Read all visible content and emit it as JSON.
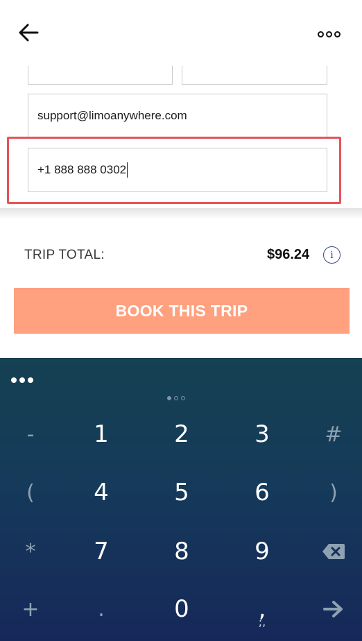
{
  "header": {
    "back_icon": "arrow-left-icon",
    "more_icon": "more-horizontal-icon"
  },
  "form": {
    "email_value": "support@limoanywhere.com",
    "phone_value": "+1 888 888 0302"
  },
  "summary": {
    "trip_total_label": "TRIP TOTAL:",
    "trip_total_amount": "$96.24",
    "info_icon": "info-icon",
    "info_glyph": "i"
  },
  "book_button": {
    "label": "BOOK THIS TRIP"
  },
  "colors": {
    "highlight": "#e5545a",
    "book_button": "#ffa07e",
    "keyboard_top": "#154152",
    "keyboard_bottom": "#16285a"
  },
  "keyboard": {
    "menu_icon": "dots-menu-icon",
    "keys": {
      "dash": "-",
      "one": "1",
      "two": "2",
      "three": "3",
      "hash": "#",
      "lparen": "(",
      "four": "4",
      "five": "5",
      "six": "6",
      "rparen": ")",
      "star": "*",
      "seven": "7",
      "eight": "8",
      "nine": "9",
      "backspace_icon": "backspace-icon",
      "plus": "+",
      "dot": ".",
      "zero": "0",
      "comma": ",",
      "comma_sub": ";,",
      "enter_icon": "arrow-right-icon"
    }
  }
}
